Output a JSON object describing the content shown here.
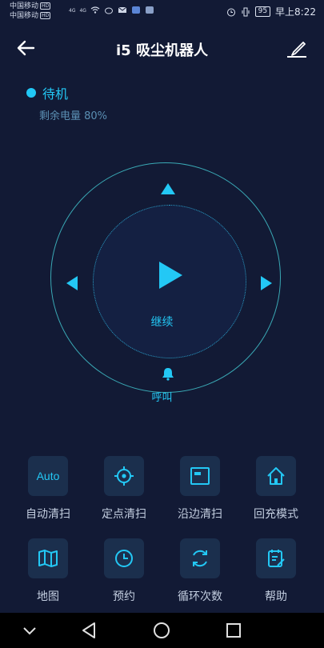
{
  "statusbar": {
    "carrier1": "中国移动",
    "carrier2": "中国移动",
    "hd": "HD",
    "signal1": "4G",
    "signal2": "4G",
    "battery": "95",
    "time": "早上8:22"
  },
  "header": {
    "title": "i5 吸尘机器人",
    "back_icon": "arrow-left-icon",
    "edit_icon": "pencil-icon"
  },
  "status": {
    "state": "待机",
    "battery_text": "剩余电量 80%"
  },
  "control": {
    "continue_label": "继续",
    "call_label": "呼叫"
  },
  "functions": [
    {
      "label": "自动清扫",
      "icon": "auto-text-icon",
      "icon_text": "Auto"
    },
    {
      "label": "定点清扫",
      "icon": "crosshair-icon"
    },
    {
      "label": "沿边清扫",
      "icon": "edge-clean-icon"
    },
    {
      "label": "回充模式",
      "icon": "home-icon"
    },
    {
      "label": "地图",
      "icon": "map-icon"
    },
    {
      "label": "预约",
      "icon": "clock-icon"
    },
    {
      "label": "循环次数",
      "icon": "cycle-icon"
    },
    {
      "label": "帮助",
      "icon": "help-doc-icon"
    }
  ],
  "colors": {
    "background": "#121a35",
    "accent": "#23c8f5",
    "tile": "#1b2f4d"
  }
}
